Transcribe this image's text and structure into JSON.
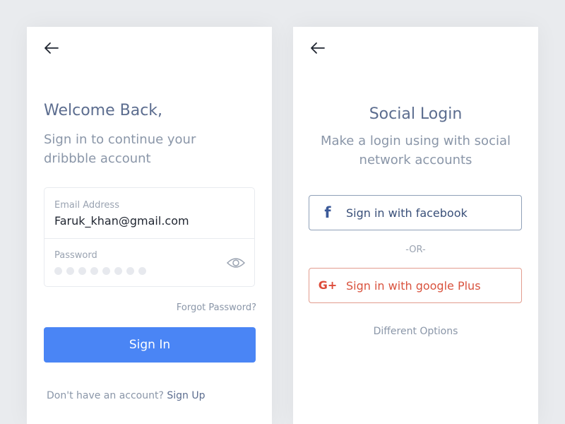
{
  "signin_screen": {
    "title": "Welcome Back,",
    "subtitle": "Sign in to continue your dribbble account",
    "email_label": "Email Address",
    "email_value": "Faruk_khan@gmail.com",
    "password_label": "Password",
    "forgot_password": "Forgot Password?",
    "signin_button": "Sign In",
    "no_account_text": "Don't have an account?",
    "signup_link": "Sign Up"
  },
  "social_screen": {
    "title": "Social Login",
    "subtitle": "Make a login using with social network accounts",
    "facebook_button": "Sign in with facebook",
    "or_divider": "-OR-",
    "google_button": "Sign in with google Plus",
    "different_options": "Different Options"
  },
  "icons": {
    "back": "arrow-left-icon",
    "eye": "eye-icon",
    "facebook": "facebook-icon",
    "google_plus": "google-plus-icon"
  },
  "colors": {
    "primary": "#4a85f5",
    "facebook": "#3b5998",
    "google": "#dd4b39"
  }
}
